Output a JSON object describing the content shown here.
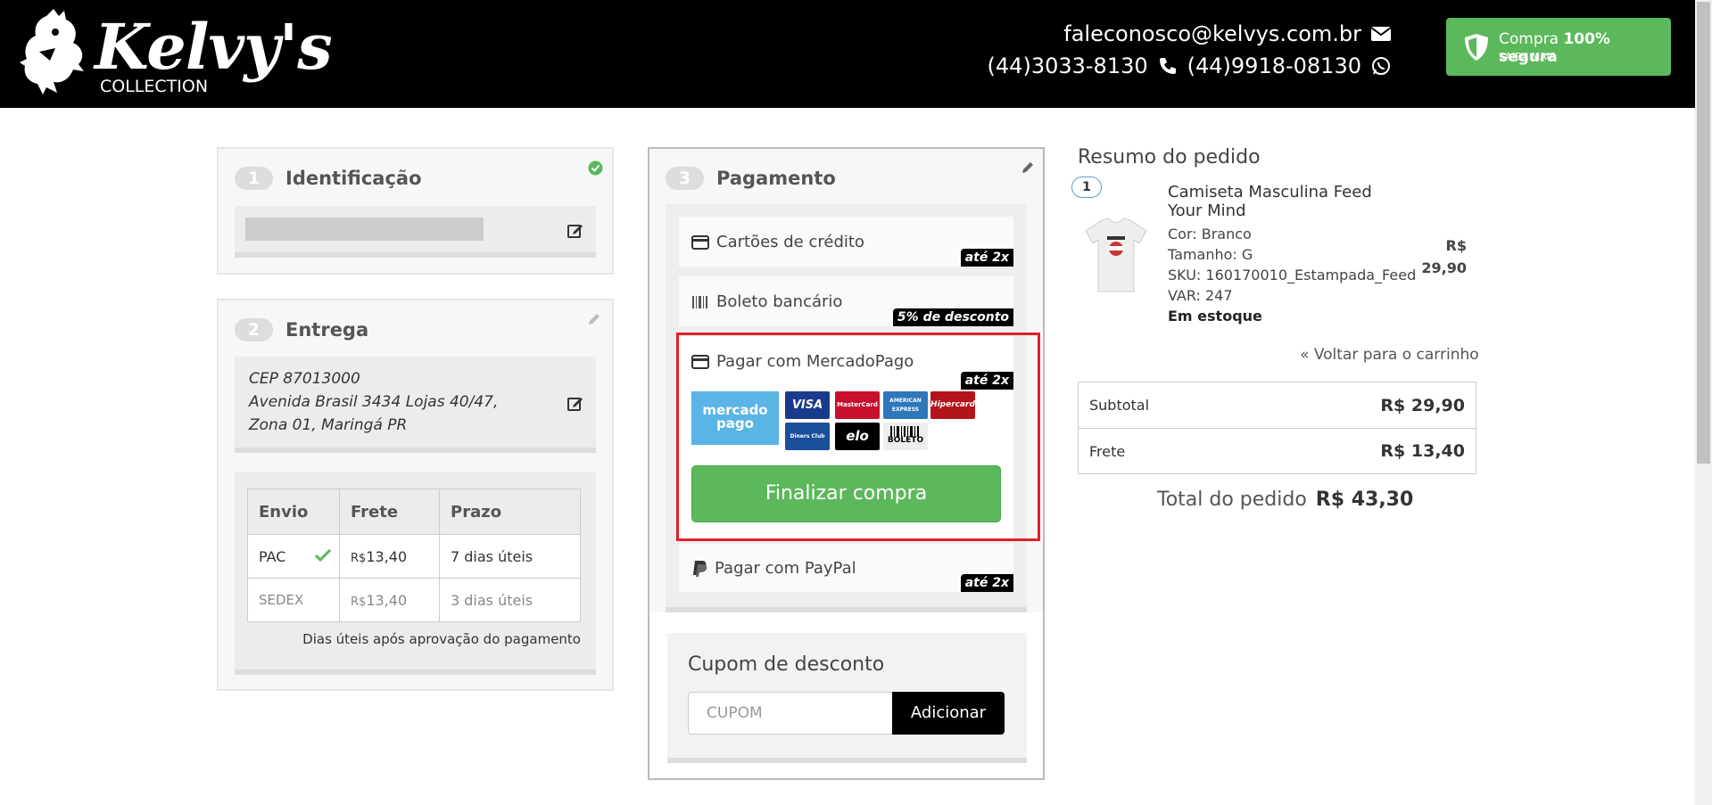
{
  "header": {
    "logo_script": "Kelvy's",
    "logo_sub": "COLLECTION",
    "email": "faleconosco@kelvys.com.br",
    "phone": "(44)3033-8130",
    "whatsapp": "(44)9918-08130",
    "secure_prefix": "Compra ",
    "secure_bold": "100% segura",
    "secure_sub": "SAIBA MAIS",
    "accent_color": "#5cb85c"
  },
  "identificacao": {
    "num": "1",
    "title": "Identificação"
  },
  "entrega": {
    "num": "2",
    "title": "Entrega",
    "address_line1": "CEP 87013000",
    "address_line2": "Avenida Brasil 3434 Lojas 40/47,",
    "address_line3": "Zona 01, Maringá PR",
    "table_headers": [
      "Envio",
      "Frete",
      "Prazo"
    ],
    "rows": [
      {
        "envio": "PAC",
        "currency": "R$",
        "frete": "13,40",
        "prazo": "7 dias úteis",
        "selected": true
      },
      {
        "envio": "SEDEX",
        "currency": "R$",
        "frete": "13,40",
        "prazo": "3 dias úteis",
        "selected": false
      }
    ],
    "note": "Dias úteis após aprovação do pagamento"
  },
  "pagamento": {
    "num": "3",
    "title": "Pagamento",
    "options": [
      {
        "label": "Cartões de crédito",
        "badge": "até 2x"
      },
      {
        "label": "Boleto bancário",
        "badge": "5% de desconto"
      },
      {
        "label": "Pagar com MercadoPago",
        "badge": "até 2x"
      },
      {
        "label": "Pagar com PayPal",
        "badge": "até 2x"
      }
    ],
    "mercadopago_logo": "mercado pago",
    "card_logos": [
      "VISA",
      "MasterCard",
      "AMERICAN EXPRESS",
      "Hipercard",
      "Diners Club",
      "elo",
      "BOLETO"
    ],
    "finalizar": "Finalizar compra"
  },
  "cupom": {
    "title": "Cupom de desconto",
    "placeholder": "CUPOM",
    "button": "Adicionar"
  },
  "resumo": {
    "title": "Resumo do pedido",
    "qty": "1",
    "product_name": "Camiseta Masculina Feed Your Mind",
    "cor": "Cor: Branco",
    "tamanho": "Tamanho: G",
    "sku": "SKU: 160170010_Estampada_Feed",
    "var": "VAR: 247",
    "stock": "Em estoque",
    "price_currency": "R$",
    "price_value": "29,90",
    "back_link": "Voltar para o carrinho",
    "subtotal_label": "Subtotal",
    "subtotal_value": "R$ 29,90",
    "frete_label": "Frete",
    "frete_value": "R$ 13,40",
    "total_label": "Total do pedido",
    "total_value": "R$ 43,30"
  }
}
